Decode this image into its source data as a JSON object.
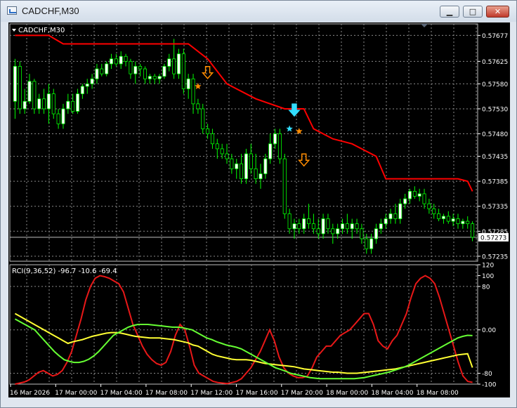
{
  "window": {
    "title": "CADCHF,M30",
    "buttons": {
      "minimize": "▁",
      "maximize": "□",
      "close": "✕"
    }
  },
  "colors": {
    "background": "#000000",
    "grid": "#8a8a8a",
    "bull_candle": "#ffffff",
    "bear_candle": "#000000",
    "candle_outline": "#00ff00",
    "stop_line": "#ff0000",
    "rci_short": "#e81818",
    "rci_mid": "#ffff33",
    "rci_long": "#66ff33",
    "axis_text": "#ffffff",
    "current_price_tag": "#ffffff",
    "sell_arrow": "#ff8c00",
    "cyan_marker": "#33ddff"
  },
  "chart_data": [
    {
      "type": "candlestick",
      "title": "CADCHF,M30",
      "ylim": [
        0.57225,
        0.577
      ],
      "y_ticks": [
        "0.57677",
        "0.57625",
        "0.57580",
        "0.57530",
        "0.57480",
        "0.57435",
        "0.57385",
        "0.57335",
        "0.57285",
        "0.57235"
      ],
      "current_price": "0.57273",
      "x_ticks": [
        "16 Mar 2026",
        "17 Mar 00:00",
        "17 Mar 04:00",
        "17 Mar 08:00",
        "17 Mar 12:00",
        "17 Mar 16:00",
        "17 Mar 20:00",
        "18 Mar 00:00",
        "18 Mar 04:00",
        "18 Mar 08:00"
      ],
      "bar_count": 96,
      "ohlc": [
        [
          0.57545,
          0.5763,
          0.5751,
          0.57615
        ],
        [
          0.57615,
          0.57625,
          0.5752,
          0.5753
        ],
        [
          0.5753,
          0.5757,
          0.5752,
          0.57545
        ],
        [
          0.57545,
          0.576,
          0.5754,
          0.57585
        ],
        [
          0.57585,
          0.5759,
          0.5752,
          0.5753
        ],
        [
          0.5753,
          0.5756,
          0.5752,
          0.5755
        ],
        [
          0.5755,
          0.5757,
          0.5752,
          0.5753
        ],
        [
          0.5753,
          0.5758,
          0.575,
          0.5756
        ],
        [
          0.5756,
          0.5757,
          0.5751,
          0.5752
        ],
        [
          0.5752,
          0.5753,
          0.5749,
          0.575
        ],
        [
          0.575,
          0.5754,
          0.5749,
          0.5753
        ],
        [
          0.5753,
          0.5756,
          0.5752,
          0.57545
        ],
        [
          0.57545,
          0.5756,
          0.5752,
          0.57525
        ],
        [
          0.57525,
          0.5757,
          0.5752,
          0.5756
        ],
        [
          0.5756,
          0.5758,
          0.5755,
          0.57575
        ],
        [
          0.57575,
          0.5759,
          0.5756,
          0.5758
        ],
        [
          0.5758,
          0.576,
          0.5757,
          0.5759
        ],
        [
          0.5759,
          0.5762,
          0.5758,
          0.5761
        ],
        [
          0.5761,
          0.5762,
          0.57595,
          0.576
        ],
        [
          0.576,
          0.57625,
          0.57595,
          0.5762
        ],
        [
          0.5762,
          0.5764,
          0.5761,
          0.5763
        ],
        [
          0.5763,
          0.5764,
          0.57615,
          0.5762
        ],
        [
          0.5762,
          0.57645,
          0.5761,
          0.57635
        ],
        [
          0.57635,
          0.5764,
          0.57615,
          0.57625
        ],
        [
          0.57625,
          0.5763,
          0.5759,
          0.576
        ],
        [
          0.576,
          0.57625,
          0.5758,
          0.57615
        ],
        [
          0.57615,
          0.5762,
          0.57595,
          0.5761
        ],
        [
          0.5761,
          0.57615,
          0.5758,
          0.5759
        ],
        [
          0.5759,
          0.576,
          0.5758,
          0.57595
        ],
        [
          0.57595,
          0.576,
          0.5758,
          0.5759
        ],
        [
          0.5759,
          0.576,
          0.5758,
          0.57595
        ],
        [
          0.57595,
          0.5762,
          0.5759,
          0.57615
        ],
        [
          0.57615,
          0.5764,
          0.57605,
          0.5763
        ],
        [
          0.5763,
          0.5767,
          0.5759,
          0.576
        ],
        [
          0.576,
          0.5765,
          0.5759,
          0.5764
        ],
        [
          0.5764,
          0.5765,
          0.5756,
          0.5757
        ],
        [
          0.5757,
          0.576,
          0.5755,
          0.5759
        ],
        [
          0.5759,
          0.576,
          0.5752,
          0.5754
        ],
        [
          0.5754,
          0.5755,
          0.5752,
          0.5753
        ],
        [
          0.5753,
          0.5754,
          0.5748,
          0.5749
        ],
        [
          0.5749,
          0.575,
          0.5747,
          0.5748
        ],
        [
          0.5748,
          0.5749,
          0.5745,
          0.5746
        ],
        [
          0.5746,
          0.5747,
          0.5743,
          0.5745
        ],
        [
          0.5745,
          0.5746,
          0.5743,
          0.5744
        ],
        [
          0.5744,
          0.5746,
          0.5742,
          0.5743
        ],
        [
          0.5743,
          0.5744,
          0.574,
          0.5741
        ],
        [
          0.5741,
          0.5743,
          0.5739,
          0.5742
        ],
        [
          0.5742,
          0.5744,
          0.5738,
          0.5739
        ],
        [
          0.5739,
          0.5745,
          0.5738,
          0.5744
        ],
        [
          0.5744,
          0.5746,
          0.574,
          0.5741
        ],
        [
          0.5741,
          0.5744,
          0.5738,
          0.5739
        ],
        [
          0.5739,
          0.5742,
          0.5737,
          0.574
        ],
        [
          0.574,
          0.5744,
          0.5739,
          0.5743
        ],
        [
          0.5743,
          0.5748,
          0.5742,
          0.5746
        ],
        [
          0.5746,
          0.5749,
          0.5745,
          0.5748
        ],
        [
          0.5748,
          0.5749,
          0.5742,
          0.5743
        ],
        [
          0.5743,
          0.5744,
          0.5731,
          0.5732
        ],
        [
          0.5732,
          0.5733,
          0.5728,
          0.5729
        ],
        [
          0.5729,
          0.5731,
          0.5727,
          0.573
        ],
        [
          0.573,
          0.5731,
          0.5728,
          0.5729
        ],
        [
          0.5729,
          0.5732,
          0.5728,
          0.5731
        ],
        [
          0.5731,
          0.5734,
          0.5729,
          0.573
        ],
        [
          0.573,
          0.5732,
          0.5728,
          0.5729
        ],
        [
          0.5729,
          0.5731,
          0.5727,
          0.5728
        ],
        [
          0.5728,
          0.5732,
          0.5727,
          0.5731
        ],
        [
          0.5731,
          0.5732,
          0.5728,
          0.5729
        ],
        [
          0.5729,
          0.573,
          0.5726,
          0.5728
        ],
        [
          0.5728,
          0.573,
          0.5727,
          0.5729
        ],
        [
          0.5729,
          0.5731,
          0.5728,
          0.573
        ],
        [
          0.573,
          0.5732,
          0.5728,
          0.5729
        ],
        [
          0.5729,
          0.5731,
          0.5727,
          0.573
        ],
        [
          0.573,
          0.5731,
          0.5728,
          0.5729
        ],
        [
          0.5729,
          0.573,
          0.5726,
          0.5727
        ],
        [
          0.5727,
          0.5728,
          0.5724,
          0.5725
        ],
        [
          0.5725,
          0.5728,
          0.5724,
          0.5727
        ],
        [
          0.5727,
          0.573,
          0.5726,
          0.5729
        ],
        [
          0.5729,
          0.5731,
          0.5728,
          0.573
        ],
        [
          0.573,
          0.5732,
          0.5729,
          0.5731
        ],
        [
          0.5731,
          0.5733,
          0.573,
          0.5732
        ],
        [
          0.5732,
          0.5734,
          0.573,
          0.5731
        ],
        [
          0.5731,
          0.5735,
          0.573,
          0.5734
        ],
        [
          0.5734,
          0.5736,
          0.5733,
          0.5735
        ],
        [
          0.5735,
          0.5737,
          0.5734,
          0.57365
        ],
        [
          0.57365,
          0.57375,
          0.5735,
          0.57355
        ],
        [
          0.57355,
          0.5737,
          0.57345,
          0.5736
        ],
        [
          0.5736,
          0.5737,
          0.5733,
          0.5734
        ],
        [
          0.5734,
          0.5735,
          0.5732,
          0.5733
        ],
        [
          0.5733,
          0.5734,
          0.5731,
          0.5732
        ],
        [
          0.5732,
          0.5733,
          0.57305,
          0.5731
        ],
        [
          0.5731,
          0.5732,
          0.573,
          0.57315
        ],
        [
          0.57315,
          0.57325,
          0.573,
          0.57305
        ],
        [
          0.57305,
          0.5732,
          0.57295,
          0.5731
        ],
        [
          0.5731,
          0.5732,
          0.5729,
          0.573
        ],
        [
          0.573,
          0.5731,
          0.5729,
          0.57305
        ],
        [
          0.57305,
          0.57315,
          0.5729,
          0.573
        ],
        [
          0.573,
          0.57305,
          0.57265,
          0.57273
        ]
      ],
      "stop_line": [
        [
          0,
          0.57677
        ],
        [
          7,
          0.57677
        ],
        [
          10,
          0.5766
        ],
        [
          36,
          0.5766
        ],
        [
          40,
          0.5763
        ],
        [
          44,
          0.5758
        ],
        [
          50,
          0.5755
        ],
        [
          56,
          0.5753
        ],
        [
          60,
          0.5753
        ],
        [
          62,
          0.5749
        ],
        [
          66,
          0.5747
        ],
        [
          70,
          0.5746
        ],
        [
          75,
          0.57435
        ],
        [
          77,
          0.5739
        ],
        [
          92,
          0.5739
        ],
        [
          94,
          0.57385
        ],
        [
          95,
          0.57365
        ]
      ],
      "markers": [
        {
          "bar": 38,
          "price": 0.57575,
          "symbol": "star",
          "color": "#ff8c00"
        },
        {
          "bar": 40,
          "price": 0.57595,
          "symbol": "down-arrow",
          "color": "#ff8c00"
        },
        {
          "bar": 57,
          "price": 0.5749,
          "symbol": "star",
          "color": "#33ddff"
        },
        {
          "bar": 58,
          "price": 0.5752,
          "symbol": "down-arrow",
          "color": "#33ddff"
        },
        {
          "bar": 59,
          "price": 0.57485,
          "symbol": "star",
          "color": "#ff8c00"
        },
        {
          "bar": 60,
          "price": 0.5742,
          "symbol": "down-arrow",
          "color": "#ff8c00"
        }
      ]
    },
    {
      "type": "line",
      "title": "RCI(9,36,52) -96.7 -10.6 -69.4",
      "ylim": [
        -100,
        120
      ],
      "y_ticks": [
        "120",
        "100",
        "80",
        "0.00",
        "-80",
        "-100"
      ],
      "series": [
        {
          "values": [
            -100,
            -98,
            -96,
            -92,
            -85,
            -78,
            -75,
            -80,
            -85,
            -82,
            -75,
            -60,
            -40,
            -10,
            20,
            55,
            80,
            95,
            100,
            98,
            95,
            90,
            85,
            70,
            40,
            10,
            -10,
            -30,
            -45,
            -55,
            -62,
            -65,
            -60,
            -40,
            -10,
            10,
            0,
            -30,
            -65,
            -80,
            -85,
            -90,
            -95,
            -97,
            -98,
            -99,
            -97,
            -95,
            -90,
            -80,
            -70,
            -55,
            -40,
            -20,
            0,
            -20,
            -50,
            -70,
            -80,
            -85,
            -88,
            -88,
            -85,
            -70,
            -50,
            -40,
            -30,
            -30,
            -20,
            -10,
            -5,
            0,
            10,
            20,
            30,
            30,
            10,
            -20,
            -30,
            -35,
            -20,
            -10,
            10,
            30,
            60,
            85,
            95,
            100,
            95,
            85,
            60,
            30,
            0,
            -30,
            -60,
            -85,
            -95,
            -96.7
          ]
        },
        {
          "values": [
            30,
            25,
            20,
            15,
            10,
            5,
            0,
            -5,
            -10,
            -15,
            -20,
            -25,
            -22,
            -20,
            -18,
            -15,
            -12,
            -10,
            -8,
            -6,
            -5,
            -5,
            -6,
            -8,
            -10,
            -12,
            -13,
            -14,
            -15,
            -15,
            -15,
            -16,
            -17,
            -18,
            -20,
            -22,
            -24,
            -28,
            -30,
            -35,
            -40,
            -45,
            -48,
            -50,
            -52,
            -54,
            -55,
            -55,
            -55,
            -56,
            -58,
            -60,
            -62,
            -63,
            -64,
            -65,
            -66,
            -67,
            -68,
            -70,
            -72,
            -73,
            -74,
            -75,
            -76,
            -77,
            -78,
            -78,
            -79,
            -80,
            -80,
            -80,
            -79,
            -78,
            -77,
            -76,
            -75,
            -74,
            -73,
            -72,
            -70,
            -68,
            -66,
            -64,
            -62,
            -60,
            -58,
            -56,
            -54,
            -52,
            -50,
            -48,
            -46,
            -45,
            -44,
            -69.4
          ]
        },
        {
          "values": [
            20,
            15,
            10,
            5,
            0,
            -10,
            -20,
            -30,
            -40,
            -48,
            -55,
            -58,
            -60,
            -60,
            -58,
            -54,
            -48,
            -40,
            -30,
            -20,
            -10,
            -5,
            0,
            5,
            8,
            10,
            10,
            10,
            9,
            8,
            7,
            6,
            5,
            5,
            4,
            2,
            0,
            -5,
            -10,
            -15,
            -18,
            -22,
            -25,
            -28,
            -30,
            -32,
            -35,
            -40,
            -45,
            -50,
            -55,
            -60,
            -65,
            -70,
            -73,
            -76,
            -80,
            -82,
            -84,
            -86,
            -88,
            -89,
            -90,
            -90,
            -90,
            -90,
            -90,
            -90,
            -90,
            -90,
            -89,
            -88,
            -86,
            -84,
            -82,
            -80,
            -78,
            -75,
            -72,
            -69,
            -65,
            -60,
            -55,
            -50,
            -45,
            -40,
            -35,
            -30,
            -25,
            -20,
            -15,
            -12,
            -10,
            -10.6
          ]
        }
      ]
    }
  ]
}
